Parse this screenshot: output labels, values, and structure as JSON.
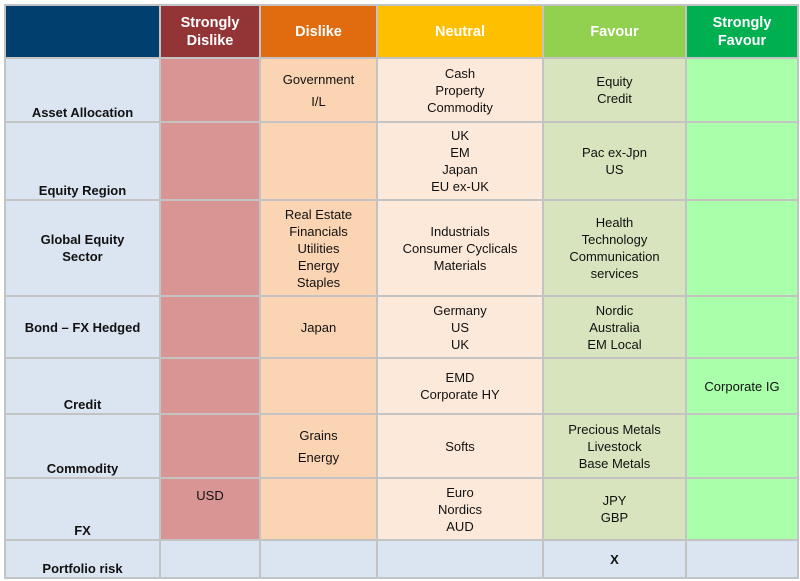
{
  "header": {
    "corner": "",
    "columns": [
      {
        "key": "strongly_dislike",
        "label_line1": "Strongly",
        "label_line2": "Dislike",
        "color": "#933436"
      },
      {
        "key": "dislike",
        "label_line1": "Dislike",
        "label_line2": "",
        "color": "#e06c0f"
      },
      {
        "key": "neutral",
        "label_line1": "Neutral",
        "label_line2": "",
        "color": "#fdbf00"
      },
      {
        "key": "favour",
        "label_line1": "Favour",
        "label_line2": "",
        "color": "#92d050"
      },
      {
        "key": "strongly_favour",
        "label_line1": "Strongly",
        "label_line2": "Favour",
        "color": "#00b050"
      }
    ]
  },
  "rows": [
    {
      "label_line1": "Asset Allocation",
      "label_line2": "",
      "strongly_dislike": [],
      "dislike": [
        "Government",
        "I/L"
      ],
      "neutral": [
        "Cash",
        "Property",
        "Commodity"
      ],
      "favour": [
        "Equity",
        "Credit"
      ],
      "strongly_favour": []
    },
    {
      "label_line1": "Equity Region",
      "label_line2": "",
      "strongly_dislike": [],
      "dislike": [],
      "neutral": [
        "UK",
        "EM",
        "Japan",
        "EU ex-UK"
      ],
      "favour": [
        "Pac ex-Jpn",
        "US"
      ],
      "strongly_favour": []
    },
    {
      "label_line1": "Global Equity",
      "label_line2": "Sector",
      "strongly_dislike": [],
      "dislike": [
        "Real Estate",
        "Financials",
        "Utilities",
        "Energy",
        "Staples"
      ],
      "neutral": [
        "Industrials",
        "Consumer Cyclicals",
        "Materials"
      ],
      "favour": [
        "Health",
        "Technology",
        "Communication",
        "services"
      ],
      "strongly_favour": []
    },
    {
      "label_line1": "Bond – FX Hedged",
      "label_line2": "",
      "strongly_dislike": [],
      "dislike": [
        "Japan"
      ],
      "neutral": [
        "Germany",
        "US",
        "UK"
      ],
      "favour": [
        "Nordic",
        "Australia",
        "EM Local"
      ],
      "strongly_favour": []
    },
    {
      "label_line1": "Credit",
      "label_line2": "",
      "strongly_dislike": [],
      "dislike": [],
      "neutral": [
        "EMD",
        "Corporate HY"
      ],
      "favour": [],
      "strongly_favour": [
        "Corporate IG"
      ]
    },
    {
      "label_line1": "Commodity",
      "label_line2": "",
      "strongly_dislike": [],
      "dislike": [
        "Grains",
        "Energy"
      ],
      "neutral": [
        "Softs"
      ],
      "favour": [
        "Precious Metals",
        "Livestock",
        "Base Metals"
      ],
      "strongly_favour": []
    },
    {
      "label_line1": "FX",
      "label_line2": "",
      "strongly_dislike": [
        "USD"
      ],
      "dislike": [],
      "neutral": [
        "Euro",
        "Nordics",
        "AUD"
      ],
      "favour": [
        "JPY",
        "GBP"
      ],
      "strongly_favour": []
    },
    {
      "label_line1": "Portfolio risk",
      "label_line2": "",
      "strongly_dislike": [],
      "dislike": [],
      "neutral": [],
      "favour": [
        "X"
      ],
      "strongly_favour": []
    }
  ]
}
